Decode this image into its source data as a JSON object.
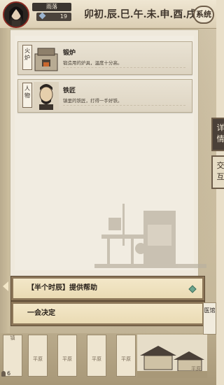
{
  "player": {
    "name": "雨落",
    "level": "19"
  },
  "time": {
    "label": "卯初.辰.巳.午.未.申.酉.戌"
  },
  "buttons": {
    "system": "系统"
  },
  "side_tabs": [
    {
      "label": "详情"
    },
    {
      "label": "交互"
    }
  ],
  "cards": [
    {
      "tag": "火炉",
      "title": "锻炉",
      "desc": "锻造用的炉具，温度十分高。"
    },
    {
      "tag": "人物",
      "title": "铁匠",
      "desc": "镇里的铁匠，打得一手好铁。"
    }
  ],
  "choices": [
    {
      "label": "【半个时辰】提供帮助"
    },
    {
      "label": "一会决定"
    }
  ],
  "bottom": {
    "population": "6",
    "slot_labels": [
      "平原",
      "平原",
      "平原",
      "平原",
      "平原"
    ],
    "slot_top_label": "镇",
    "doc_label": "医馆"
  },
  "colors": {
    "accent_dark": "#4a4038",
    "choice_bg": "#f3e7c8",
    "diamond": "#6da58e"
  }
}
